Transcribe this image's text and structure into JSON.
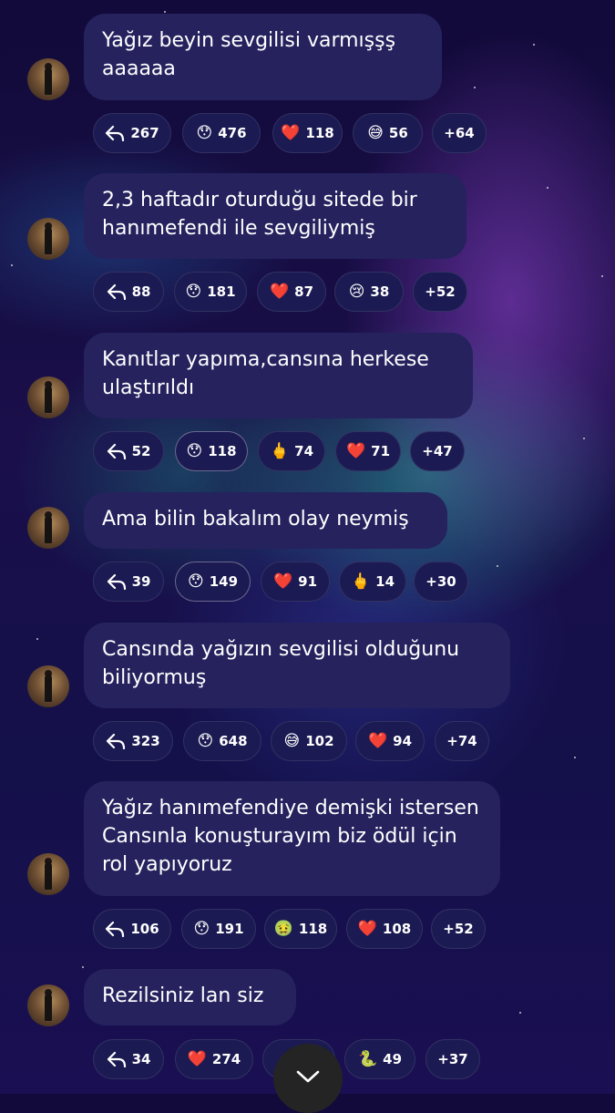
{
  "messages": [
    {
      "text": "Yağız beyin sevgilisi varmışşş aaaaaa",
      "reactions": [
        {
          "icon": "reply-icon",
          "glyph": "",
          "count": "267",
          "active": false
        },
        {
          "icon": "astonished-face-icon",
          "glyph": "😯",
          "count": "476",
          "active": false
        },
        {
          "icon": "red-heart-icon",
          "glyph": "❤️",
          "count": "118",
          "active": false
        },
        {
          "icon": "grinning-sweat-face-icon",
          "glyph": "😅",
          "count": "56",
          "active": false
        },
        {
          "icon": "",
          "glyph": "",
          "count": "+64",
          "active": false
        }
      ]
    },
    {
      "text": "2,3 haftadır oturduğu sitede bir hanımefendi ile sevgiliymiş",
      "reactions": [
        {
          "icon": "reply-icon",
          "glyph": "",
          "count": "88",
          "active": false
        },
        {
          "icon": "astonished-face-icon",
          "glyph": "😯",
          "count": "181",
          "active": false
        },
        {
          "icon": "red-heart-icon",
          "glyph": "❤️",
          "count": "87",
          "active": false
        },
        {
          "icon": "crying-face-icon",
          "glyph": "😢",
          "count": "38",
          "active": false
        },
        {
          "icon": "",
          "glyph": "",
          "count": "+52",
          "active": false
        }
      ]
    },
    {
      "text": "Kanıtlar yapıma,cansına herkese ulaştırıldı",
      "reactions": [
        {
          "icon": "reply-icon",
          "glyph": "",
          "count": "52",
          "active": false
        },
        {
          "icon": "astonished-face-icon",
          "glyph": "😯",
          "count": "118",
          "active": true
        },
        {
          "icon": "middle-finger-icon",
          "glyph": "🖕",
          "count": "74",
          "active": false
        },
        {
          "icon": "red-heart-icon",
          "glyph": "❤️",
          "count": "71",
          "active": false
        },
        {
          "icon": "",
          "glyph": "",
          "count": "+47",
          "active": false
        }
      ]
    },
    {
      "text": "Ama bilin bakalım olay neymiş",
      "reactions": [
        {
          "icon": "reply-icon",
          "glyph": "",
          "count": "39",
          "active": false
        },
        {
          "icon": "astonished-face-icon",
          "glyph": "😯",
          "count": "149",
          "active": true
        },
        {
          "icon": "red-heart-icon",
          "glyph": "❤️",
          "count": "91",
          "active": false
        },
        {
          "icon": "middle-finger-icon",
          "glyph": "🖕",
          "count": "14",
          "active": false
        },
        {
          "icon": "",
          "glyph": "",
          "count": "+30",
          "active": false
        }
      ]
    },
    {
      "text": "Cansında yağızın sevgilisi olduğunu biliyormuş",
      "reactions": [
        {
          "icon": "reply-icon",
          "glyph": "",
          "count": "323",
          "active": false
        },
        {
          "icon": "astonished-face-icon",
          "glyph": "😯",
          "count": "648",
          "active": false
        },
        {
          "icon": "grinning-sweat-face-icon",
          "glyph": "😅",
          "count": "102",
          "active": false
        },
        {
          "icon": "red-heart-icon",
          "glyph": "❤️",
          "count": "94",
          "active": false
        },
        {
          "icon": "",
          "glyph": "",
          "count": "+74",
          "active": false
        }
      ]
    },
    {
      "text": "Yağız hanımefendiye demişki istersen Cansınla konuşturayım biz ödül için rol yapıyoruz",
      "reactions": [
        {
          "icon": "reply-icon",
          "glyph": "",
          "count": "106",
          "active": false
        },
        {
          "icon": "astonished-face-icon",
          "glyph": "😯",
          "count": "191",
          "active": false
        },
        {
          "icon": "nauseated-face-icon",
          "glyph": "🤢",
          "count": "118",
          "active": false
        },
        {
          "icon": "red-heart-icon",
          "glyph": "❤️",
          "count": "108",
          "active": false
        },
        {
          "icon": "",
          "glyph": "",
          "count": "+52",
          "active": false
        }
      ]
    },
    {
      "text": "Rezilsiniz lan siz",
      "reactions": [
        {
          "icon": "reply-icon",
          "glyph": "",
          "count": "34",
          "active": false
        },
        {
          "icon": "red-heart-icon",
          "glyph": "❤️",
          "count": "274",
          "active": false
        },
        {
          "icon": "hidden-reaction-icon",
          "glyph": "",
          "count": "",
          "active": false
        },
        {
          "icon": "snake-icon",
          "glyph": "🐍",
          "count": "49",
          "active": false
        },
        {
          "icon": "",
          "glyph": "",
          "count": "+37",
          "active": false
        }
      ]
    }
  ],
  "scroll_button_icon": "chevron-down-icon",
  "colors": {
    "bubble": "#25225e",
    "chip": "#1b1a52",
    "scroll_button": "#242424"
  }
}
